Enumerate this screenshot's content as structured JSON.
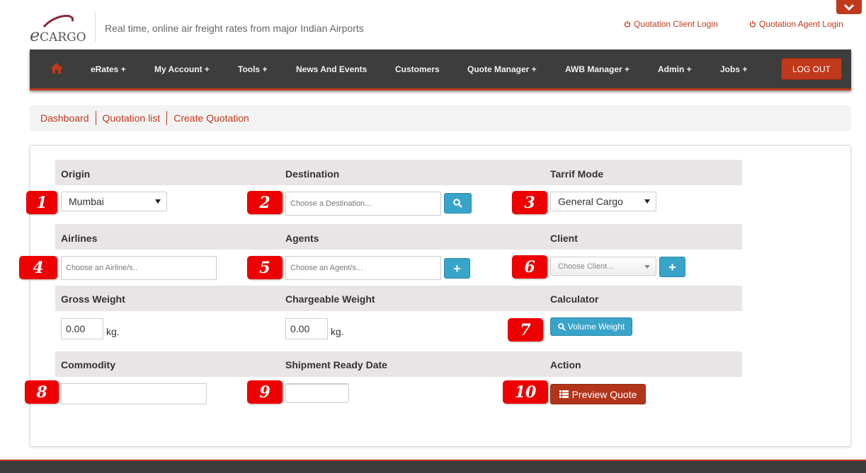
{
  "header": {
    "logo_text": "eCARGO",
    "tagline": "Real time, online air freight rates from major Indian Airports",
    "links": {
      "client_login": "Quotation Client Login",
      "agent_login": "Quotation Agent Login"
    }
  },
  "nav": {
    "items": [
      "eRates +",
      "My Account +",
      "Tools +",
      "News And Events",
      "Customers",
      "Quote Manager +",
      "AWB Manager +",
      "Admin +",
      "Jobs +"
    ],
    "logout": "LOG OUT"
  },
  "breadcrumb": [
    "Dashboard",
    "Quotation list",
    "Create Quotation"
  ],
  "form": {
    "labels": {
      "origin": "Origin",
      "destination": "Destination",
      "tariff_mode": "Tarrif Mode",
      "airlines": "Airlines",
      "agents": "Agents",
      "client": "Client",
      "gross_weight": "Gross Weight",
      "chargeable_weight": "Chargeable Weight",
      "calculator": "Calculator",
      "commodity": "Commodity",
      "shipment_ready_date": "Shipment Ready Date",
      "action": "Action"
    },
    "origin_value": "Mumbai",
    "destination_placeholder": "Choose a Destination...",
    "tariff_mode_value": "General Cargo",
    "airlines_placeholder": "Choose an Airline/s..",
    "agents_placeholder": "Choose an Agent/s...",
    "client_placeholder": "Choose Client...",
    "gross_weight_value": "0.00",
    "chargeable_weight_value": "0.00",
    "unit": "kg.",
    "volume_weight_button": "Volume Weight",
    "add_button": "+",
    "commodity_value": "",
    "shipment_date_value": "",
    "preview_quote_button": "Preview Quote"
  },
  "annotations": [
    "1",
    "2",
    "3",
    "4",
    "5",
    "6",
    "7",
    "8",
    "9",
    "10"
  ],
  "colors": {
    "accent": "#c0391b",
    "nav_bg": "#3d3d3d",
    "button_blue": "#39a4c9",
    "badge_red": "#ee0000",
    "row_header": "#e9e5e6"
  }
}
